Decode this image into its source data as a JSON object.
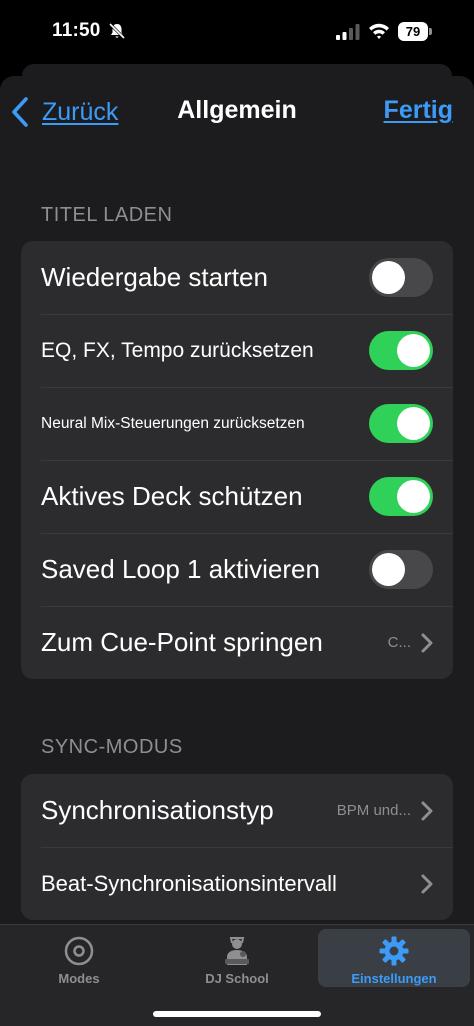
{
  "status": {
    "time": "11:50",
    "battery": "79"
  },
  "nav": {
    "back_label": "Zurück",
    "title": "Allgemein",
    "done_label": "Fertig"
  },
  "sections": {
    "load_track": {
      "header": "TITEL LADEN",
      "rows": [
        {
          "label": "Wiedergabe starten",
          "on": false
        },
        {
          "label": "EQ, FX, Tempo zurücksetzen",
          "on": true
        },
        {
          "label": "Neural Mix-Steuerungen zurücksetzen",
          "on": true
        },
        {
          "label": "Aktives Deck schützen",
          "on": true
        },
        {
          "label": "Saved Loop 1 aktivieren",
          "on": false
        },
        {
          "label": "Zum Cue-Point springen",
          "value": "C..."
        }
      ]
    },
    "sync": {
      "header": "SYNC-MODUS",
      "rows": [
        {
          "label": "Synchronisationstyp",
          "value": "BPM und..."
        },
        {
          "label": "Beat-Synchronisationsintervall"
        }
      ]
    }
  },
  "tabs": [
    {
      "label": "Modes",
      "icon": "disc-icon"
    },
    {
      "label": "DJ School",
      "icon": "dj-school-icon"
    },
    {
      "label": "Einstellungen",
      "icon": "gear-icon",
      "active": true
    }
  ],
  "colors": {
    "accent": "#3d9bf8",
    "toggle_on": "#30d158",
    "toggle_off": "#48484a",
    "background": "#1c1c1e",
    "cell": "#2c2c2e"
  }
}
